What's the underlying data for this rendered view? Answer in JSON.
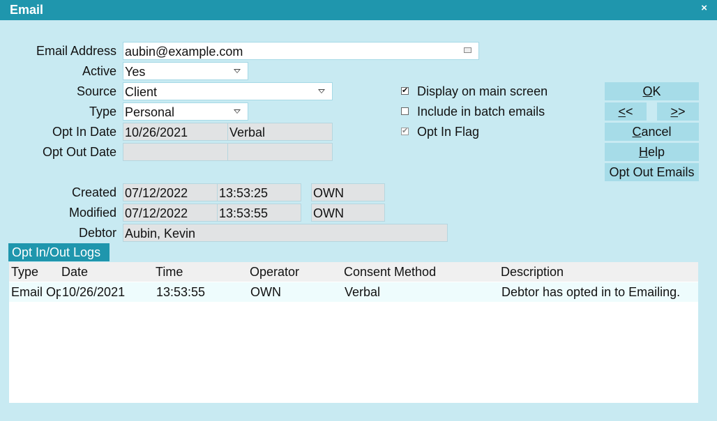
{
  "window": {
    "title": "Email",
    "close_glyph": "×"
  },
  "form": {
    "email_label": "Email Address",
    "email_value": "aubin@example.com",
    "email_icon": "envelope-icon",
    "active_label": "Active",
    "active_value": "Yes",
    "source_label": "Source",
    "source_value": "Client",
    "type_label": "Type",
    "type_value": "Personal",
    "optin_label": "Opt In Date",
    "optin_date": "10/26/2021",
    "optin_method": "Verbal",
    "optout_label": "Opt Out Date",
    "optout_date": "",
    "optout_method": "",
    "created_label": "Created",
    "created_date": "07/12/2022",
    "created_time": "13:53:25",
    "created_user": "OWN",
    "modified_label": "Modified",
    "modified_date": "07/12/2022",
    "modified_time": "13:53:55",
    "modified_user": "OWN",
    "debtor_label": "Debtor",
    "debtor_value": "Aubin, Kevin"
  },
  "options": {
    "display_main": {
      "label": "Display on main screen",
      "checked": true
    },
    "batch_emails": {
      "label": "Include in batch emails",
      "checked": false
    },
    "opt_in_flag": {
      "label": "Opt In Flag",
      "checked": true,
      "disabled": true
    },
    "check_glyph": "✔"
  },
  "buttons": {
    "ok_key": "O",
    "ok_rest": "K",
    "prev_key": "<",
    "prev_rest": "<",
    "next_key": ">",
    "next_rest": ">",
    "cancel_key": "C",
    "cancel_rest": "ancel",
    "help_key": "H",
    "help_rest": "elp",
    "opt_out": "Opt Out Emails"
  },
  "logs": {
    "tab_label": "Opt In/Out Logs",
    "columns": [
      "Type",
      "Date",
      "Time",
      "Operator",
      "Consent Method",
      "Description"
    ],
    "rows": [
      [
        "Email Opt In",
        "10/26/2021",
        "13:53:55",
        "OWN",
        "Verbal",
        "Debtor has opted in to Emailing."
      ]
    ]
  }
}
